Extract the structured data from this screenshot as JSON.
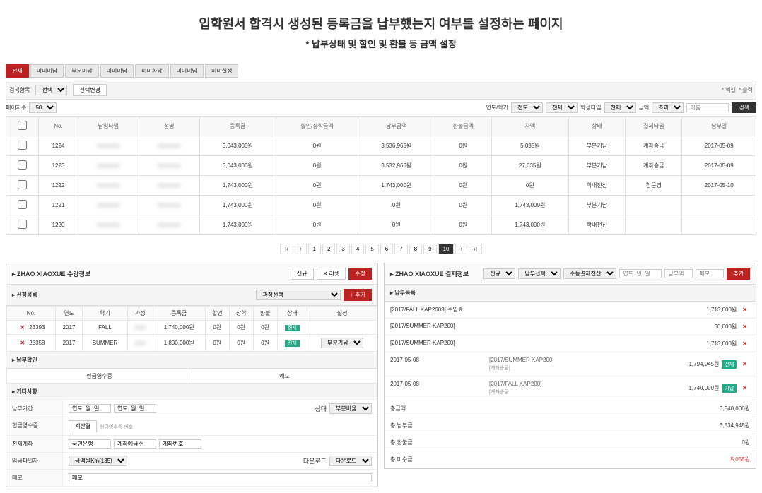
{
  "header": {
    "title": "입학원서 합격시 생성된 등록금을 납부했는지 여부를 설정하는 페이지",
    "subtitle": "* 납부상태 및 할인 및 환불 등 금액 설정"
  },
  "tabs": [
    {
      "label": "전체",
      "active": true
    },
    {
      "label": "미미미납"
    },
    {
      "label": "부분미납"
    },
    {
      "label": "미미미납"
    },
    {
      "label": "미미환납"
    },
    {
      "label": "미미미납"
    },
    {
      "label": "미미설정"
    }
  ],
  "filterbar": {
    "label1": "검색항목",
    "change_label": "선택변경",
    "pagesize_label": "페이지수",
    "pagesize_value": "50",
    "year_label": "연도/학기",
    "year_value": "전도",
    "all_value": "전체",
    "type_label": "학생타입",
    "type_value": "전체",
    "amount_label": "금액",
    "amount_value": "초과",
    "search_placeholder": "이름",
    "search_btn": "검색",
    "link_excel": "* 엑셀",
    "link_print": "* 출력"
  },
  "table": {
    "cols": [
      "",
      "No.",
      "납입타입",
      "성명",
      "등록금",
      "할인/장학금액",
      "납부금액",
      "환불금액",
      "차액",
      "상태",
      "결제타입",
      "납부일"
    ],
    "rows": [
      {
        "no": "1224",
        "type": "",
        "name": "",
        "amt": "3,043,000원",
        "disc": "0원",
        "paid": "3,536,965원",
        "refund": "0원",
        "diff": "5,035원",
        "status": "부분기납",
        "ptype": "계좌송금",
        "date": "2017-05-09"
      },
      {
        "no": "1223",
        "type": "",
        "name": "",
        "amt": "3,043,000원",
        "disc": "0원",
        "paid": "3,532,965원",
        "refund": "0원",
        "diff": "27,035원",
        "status": "부분기납",
        "ptype": "계좌송금",
        "date": "2017-05-09"
      },
      {
        "no": "1222",
        "type": "",
        "name": "",
        "amt": "1,743,000원",
        "disc": "0원",
        "paid": "1,743,000원",
        "refund": "0원",
        "diff": "0원",
        "status": "학내전산",
        "ptype": "창문경",
        "date": "2017-05-10"
      },
      {
        "no": "1221",
        "type": "",
        "name": "",
        "amt": "1,743,000원",
        "disc": "0원",
        "paid": "0원",
        "refund": "0원",
        "diff": "1,743,000원",
        "status": "부분기납",
        "ptype": "",
        "date": ""
      },
      {
        "no": "1220",
        "type": "",
        "name": "",
        "amt": "1,743,000원",
        "disc": "0원",
        "paid": "0원",
        "refund": "0원",
        "diff": "1,743,000원",
        "status": "학내전산",
        "ptype": "",
        "date": ""
      }
    ]
  },
  "pagination": [
    "1",
    "2",
    "3",
    "4",
    "5",
    "6",
    "7",
    "8",
    "9",
    "10"
  ],
  "pagination_active": "10",
  "left_panel": {
    "title_prefix": "ZHAO XIAOXUE 수강정보",
    "btn_new": "신규",
    "btn_reset": "✕ 리셋",
    "btn_edit": "수정",
    "section1": "신청목록",
    "section1_select": "과정선택",
    "section1_add": "+ 추가",
    "cols": [
      "No.",
      "연도",
      "학기",
      "과정",
      "등록금",
      "할인",
      "장학",
      "환불",
      "상태",
      "설정"
    ],
    "rows": [
      {
        "no": "23393",
        "year": "2017",
        "sem": "FALL",
        "course": "",
        "amt": "1,740,000원",
        "d1": "0원",
        "d2": "0원",
        "d3": "0원",
        "status": "전체",
        "setting": ""
      },
      {
        "no": "23358",
        "year": "2017",
        "sem": "SUMMER",
        "course": "",
        "amt": "1,800,000원",
        "d1": "0원",
        "d2": "0원",
        "d3": "0원",
        "status": "전체",
        "setting": "부분기납"
      }
    ],
    "section2": "납부확인",
    "bank_label": "현금영수증",
    "bank_value": "예도",
    "section3": "기타사항",
    "form": {
      "period_label": "납부기간",
      "period_from": "연도. 월. 일",
      "period_to": "연도. 월. 일",
      "period_status": "상태",
      "period_setting": "부분비율",
      "cash_label": "현금영수증",
      "cash_btn": "계산결",
      "cash_note": "현금영수증 번호",
      "bank_label": "전체계좌",
      "bank_v1": "국민은행",
      "bank_v2": "계좌예금주",
      "bank_v3": "계좌번호",
      "file_label": "입금파일자",
      "file_value": "금액원Km(135)",
      "dl_label": "다운로드",
      "dl_value": "다운로드",
      "memo_label": "메모",
      "memo_value": "메모"
    }
  },
  "right_panel": {
    "title_prefix": "ZHAO XIAOXUE 결제정보",
    "sel1": "신규",
    "sel2": "납부선택",
    "sel3": "수동결제전산",
    "date_ph": "연도. 년. 일",
    "amt_ph": "납부액",
    "memo_ph": "메모",
    "btn_add": "추가",
    "section1": "납부목록",
    "rows": [
      {
        "label": "[2017/FALL KAP2003] 수입료",
        "amt": "1,713,000원"
      },
      {
        "label": "[2017/SUMMER KAP200]",
        "amt": "60,000원"
      },
      {
        "label": "[2017/SUMMER KAP200]",
        "amt": "1,713,000원"
      }
    ],
    "payments": [
      {
        "date": "2017-05-08",
        "detail": "[2017/SUMMER KAP200]",
        "note": "[계좌송금]",
        "amt": "1,794,945원",
        "tag": "전체"
      },
      {
        "date": "2017-05-08",
        "detail": "[2017/FALL KAP200]",
        "note": "[계좌송금",
        "amt": "1,740,000원",
        "tag": "기납"
      }
    ],
    "summary": [
      {
        "label": "총금액",
        "value": "3,540,000원"
      },
      {
        "label": "총 납부금",
        "value": "3,534,945원"
      },
      {
        "label": "총 환불금",
        "value": "0원"
      },
      {
        "label": "총 미수금",
        "value": "5,055원",
        "red": true
      }
    ]
  }
}
